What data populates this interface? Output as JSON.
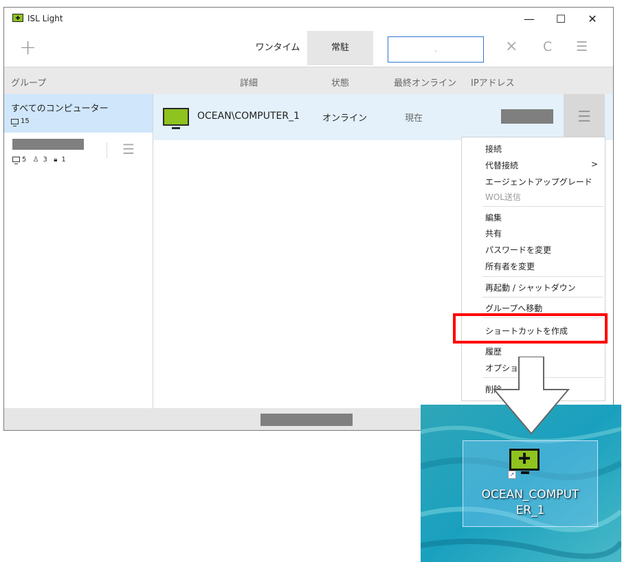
{
  "window": {
    "title": "ISL Light"
  },
  "titlebar": {
    "minimize": "—",
    "maximize": "☐",
    "close": "✕"
  },
  "toolbar": {
    "add": "+",
    "tabs": [
      {
        "label": "ワンタイム"
      },
      {
        "label": "常駐"
      }
    ],
    "search_value": ".",
    "clear": "×",
    "refresh": "C",
    "menu": "☰"
  },
  "columns": {
    "group": "グループ",
    "detail": "詳細",
    "status": "状態",
    "last_online": "最終オンライン",
    "ip": "IPアドレス"
  },
  "sidebar": {
    "all": {
      "label": "すべてのコンピューター",
      "count": "15"
    },
    "group2": {
      "computers": "5",
      "users": "3",
      "locked": "1"
    }
  },
  "computer_row": {
    "name": "OCEAN\\COMPUTER_1",
    "status": "オンライン",
    "last_online": "現在"
  },
  "context_menu": {
    "items": [
      "接続",
      "代替接続",
      "エージェントアップグレード",
      "WOL送信",
      "編集",
      "共有",
      "パスワードを変更",
      "所有者を変更",
      "再起動 / シャットダウン",
      "グループへ移動",
      "ショートカットを作成",
      "履歴",
      "オプション",
      "削除"
    ],
    "submenu_arrow": ">"
  },
  "desktop": {
    "shortcut_label_1": "OCEAN_COMPUT",
    "shortcut_label_2": "ER_1"
  },
  "colors": {
    "accent": "#2e76d0",
    "selected": "#cfe6fb",
    "row": "#e4f1fb",
    "monitor": "#8fc31f",
    "highlight": "#ff0000"
  }
}
